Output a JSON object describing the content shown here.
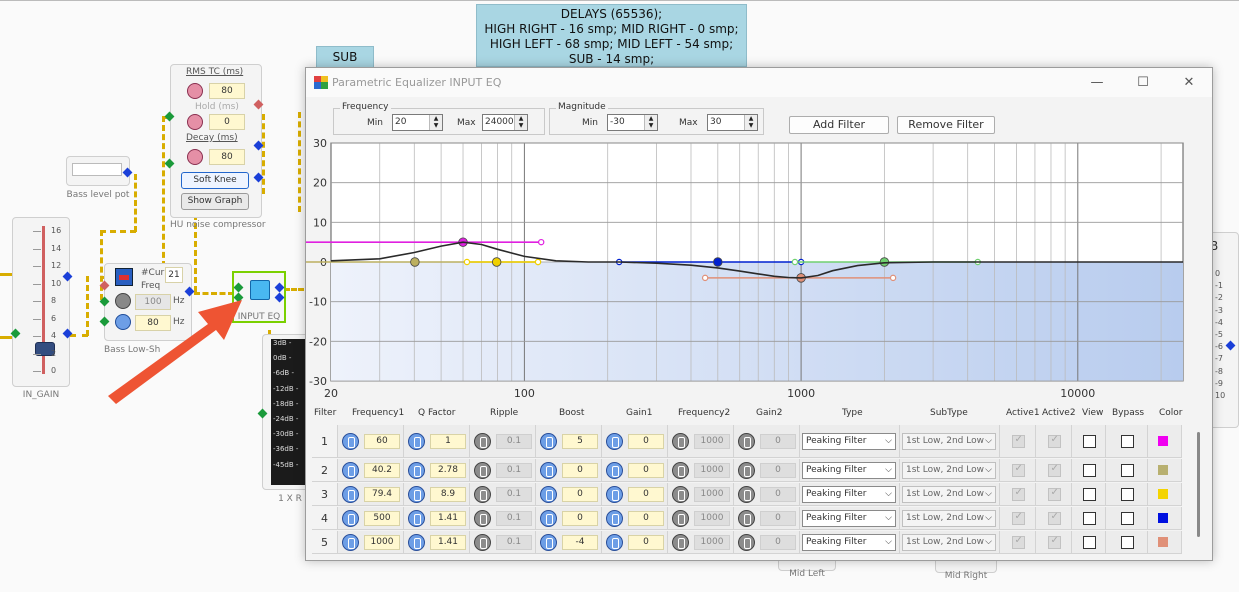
{
  "background": {
    "delays": {
      "line1": "DELAYS (65536);",
      "line2": "HIGH RIGHT - 16 smp; MID RIGHT - 0 smp;",
      "line3": "HIGH LEFT - 68 smp; MID LEFT - 54 smp;",
      "line4": "SUB - 14 smp;"
    },
    "sub_tag": "SUB",
    "compressor": {
      "rms_label": "RMS TC (ms)",
      "rms_value": "80",
      "hold_label": "Hold (ms)",
      "hold_value": "0",
      "decay_label": "Decay (ms)",
      "decay_value": "80",
      "soft_knee": "Soft Knee",
      "show_graph": "Show Graph",
      "caption": "HU noise compressor"
    },
    "bass_level": {
      "caption": "Bass level pot"
    },
    "in_gain": {
      "caption": "IN_GAIN",
      "ticks": [
        "16",
        "14",
        "12",
        "10",
        "8",
        "6",
        "4",
        "2",
        "0"
      ]
    },
    "bass_shelf": {
      "cur_label": "#Cur",
      "cur_value": "21",
      "freq_label": "Freq",
      "v1": "100",
      "v2": "80",
      "unit": "Hz",
      "caption": "Bass Low-Sh"
    },
    "input_eq": {
      "caption": "INPUT EQ"
    },
    "meter": {
      "labels": [
        "3dB -",
        "0dB -",
        "-6dB -",
        "-12dB -",
        "-18dB -",
        "-24dB -",
        "-30dB -",
        "-36dB -",
        "-45dB -"
      ],
      "caption": "1 X R"
    },
    "right_block": {
      "title": "B",
      "ticks": [
        "0",
        "-1",
        "-2",
        "-3",
        "-4",
        "-5",
        "-6",
        "-7",
        "-8",
        "-9",
        "10"
      ]
    },
    "mid_left": "Mid Left",
    "mid_right": "Mid Right"
  },
  "window": {
    "title": "Parametric Equalizer INPUT EQ",
    "minimize": "—",
    "maximize": "☐",
    "close": "✕"
  },
  "frequency_group": {
    "title": "Frequency",
    "min_label": "Min",
    "min_value": "20",
    "max_label": "Max",
    "max_value": "24000"
  },
  "magnitude_group": {
    "title": "Magnitude",
    "min_label": "Min",
    "min_value": "-30",
    "max_label": "Max",
    "max_value": "30"
  },
  "add_filter": "Add Filter",
  "remove_filter": "Remove Filter",
  "chart_data": {
    "type": "line",
    "x_scale": "log",
    "xlim": [
      20,
      24000
    ],
    "ylim": [
      -30,
      30
    ],
    "x_ticks": [
      "20",
      "100",
      "1000",
      "10000"
    ],
    "y_ticks": [
      "30",
      "20",
      "10",
      "0",
      "-10",
      "-20",
      "-30"
    ],
    "grid": true,
    "response_curve": {
      "x": [
        20,
        30,
        40,
        50,
        60,
        70,
        80,
        100,
        130,
        170,
        220,
        300,
        400,
        500,
        600,
        700,
        800,
        900,
        1000,
        1150,
        1300,
        1600,
        2000,
        3000,
        5000,
        10000,
        24000
      ],
      "y": [
        0.3,
        0.8,
        2.4,
        4.0,
        5.0,
        4.4,
        3.2,
        1.4,
        0.3,
        0,
        0,
        -0.3,
        -0.8,
        -1.5,
        -2.3,
        -3.0,
        -3.6,
        -3.9,
        -4.0,
        -3.4,
        -2.2,
        -0.9,
        -0.2,
        0,
        0,
        0,
        0
      ]
    },
    "filters": [
      {
        "center": 60,
        "gain": 5,
        "lo": 15.5,
        "hi": 115,
        "color": "#e020e0"
      },
      {
        "center": 40.2,
        "gain": 0,
        "lo": 15.5,
        "hi": 112,
        "color": "#bcb060"
      },
      {
        "center": 79.4,
        "gain": 0,
        "lo": 62,
        "hi": 112,
        "color": "#f0d000"
      },
      {
        "center": 500,
        "gain": 0,
        "lo": 220,
        "hi": 1000,
        "color": "#0020d0"
      },
      {
        "center": 1000,
        "gain": -4,
        "lo": 450,
        "hi": 2150,
        "color": "#e09078"
      },
      {
        "center": 2000,
        "gain": 0,
        "lo": 950,
        "hi": 4350,
        "color": "#70d070"
      }
    ]
  },
  "table": {
    "headers": [
      "Filter",
      "Frequency1",
      "Q Factor",
      "Ripple",
      "Boost",
      "Gain1",
      "Frequency2",
      "Gain2",
      "Type",
      "SubType",
      "Active1",
      "Active2",
      "View",
      "Bypass",
      "Color"
    ],
    "rows": [
      {
        "id": "1",
        "freq1": "60",
        "q": "1",
        "ripple": "0.1",
        "boost": "5",
        "gain1": "0",
        "freq2": "1000",
        "gain2": "0",
        "type": "Peaking Filter",
        "subtype": "1st Low, 2nd Low",
        "color": "#f000f0"
      },
      {
        "id": "2",
        "freq1": "40.2",
        "q": "2.78",
        "ripple": "0.1",
        "boost": "0",
        "gain1": "0",
        "freq2": "1000",
        "gain2": "0",
        "type": "Peaking Filter",
        "subtype": "1st Low, 2nd Low",
        "color": "#b8b070"
      },
      {
        "id": "3",
        "freq1": "79.4",
        "q": "8.9",
        "ripple": "0.1",
        "boost": "0",
        "gain1": "0",
        "freq2": "1000",
        "gain2": "0",
        "type": "Peaking Filter",
        "subtype": "1st Low, 2nd Low",
        "color": "#f4d400"
      },
      {
        "id": "4",
        "freq1": "500",
        "q": "1.41",
        "ripple": "0.1",
        "boost": "0",
        "gain1": "0",
        "freq2": "1000",
        "gain2": "0",
        "type": "Peaking Filter",
        "subtype": "1st Low, 2nd Low",
        "color": "#0010e0"
      },
      {
        "id": "5",
        "freq1": "1000",
        "q": "1.41",
        "ripple": "0.1",
        "boost": "-4",
        "gain1": "0",
        "freq2": "1000",
        "gain2": "0",
        "type": "Peaking Filter",
        "subtype": "1st Low, 2nd Low",
        "color": "#e09078"
      }
    ]
  }
}
